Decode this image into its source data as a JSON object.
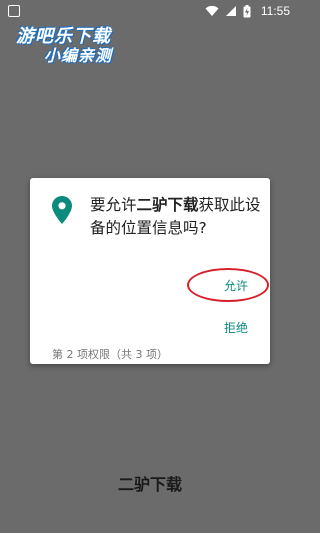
{
  "status_bar": {
    "time": "11:55",
    "icons": [
      "wifi-icon",
      "signal-icon",
      "battery-charging-icon"
    ]
  },
  "watermark": {
    "line1": "游吧乐下载",
    "line2": "小编亲测"
  },
  "dialog": {
    "question_prefix": "要允许",
    "app_name": "二驴下载",
    "question_suffix": "获取此设备的位置信息吗?",
    "allow_label": "允许",
    "deny_label": "拒绝",
    "permission_count": "第 2 项权限（共 3 项）",
    "icon": "location-pin-icon"
  },
  "background_app_name": "二驴下载",
  "colors": {
    "accent": "#0c8a7d",
    "highlight_annotation": "#d8202a",
    "scrim": "#6b6b6b"
  }
}
